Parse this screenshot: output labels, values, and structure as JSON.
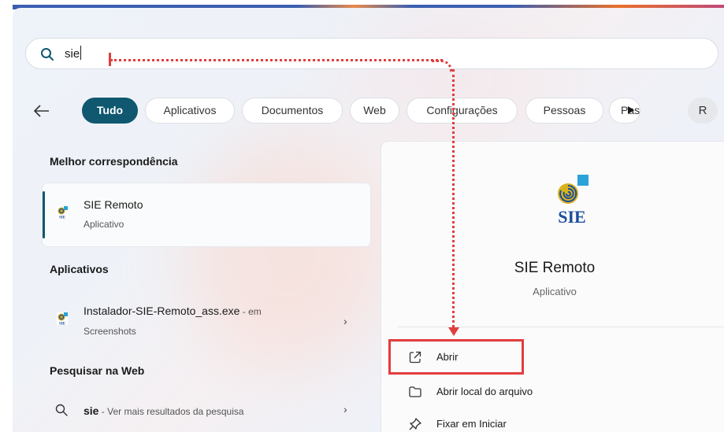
{
  "search": {
    "query": "sie"
  },
  "filters": {
    "items": [
      {
        "label": "Tudo",
        "active": true
      },
      {
        "label": "Aplicativos"
      },
      {
        "label": "Documentos"
      },
      {
        "label": "Web"
      },
      {
        "label": "Configurações"
      },
      {
        "label": "Pessoas"
      },
      {
        "label": "Pas"
      }
    ],
    "avatar_letter": "R"
  },
  "best_match": {
    "title": "Melhor correspondência",
    "name": "SIE Remoto",
    "type": "Aplicativo"
  },
  "apps": {
    "title": "Aplicativos",
    "item_name": "Instalador-SIE-Remoto_ass.exe",
    "item_suffix": " - em",
    "item_location": "Screenshots"
  },
  "web": {
    "title": "Pesquisar na Web",
    "query": "sie",
    "suffix": " - Ver mais resultados da pesquisa"
  },
  "detail": {
    "logo_text": "SIE",
    "name": "SIE Remoto",
    "type": "Aplicativo",
    "actions": [
      {
        "label": "Abrir",
        "icon": "open-external-icon"
      },
      {
        "label": "Abrir local do arquivo",
        "icon": "folder-icon"
      },
      {
        "label": "Fixar em Iniciar",
        "icon": "pin-icon"
      }
    ]
  },
  "colors": {
    "accent": "#0f5870",
    "annotation": "#e23d3d"
  }
}
